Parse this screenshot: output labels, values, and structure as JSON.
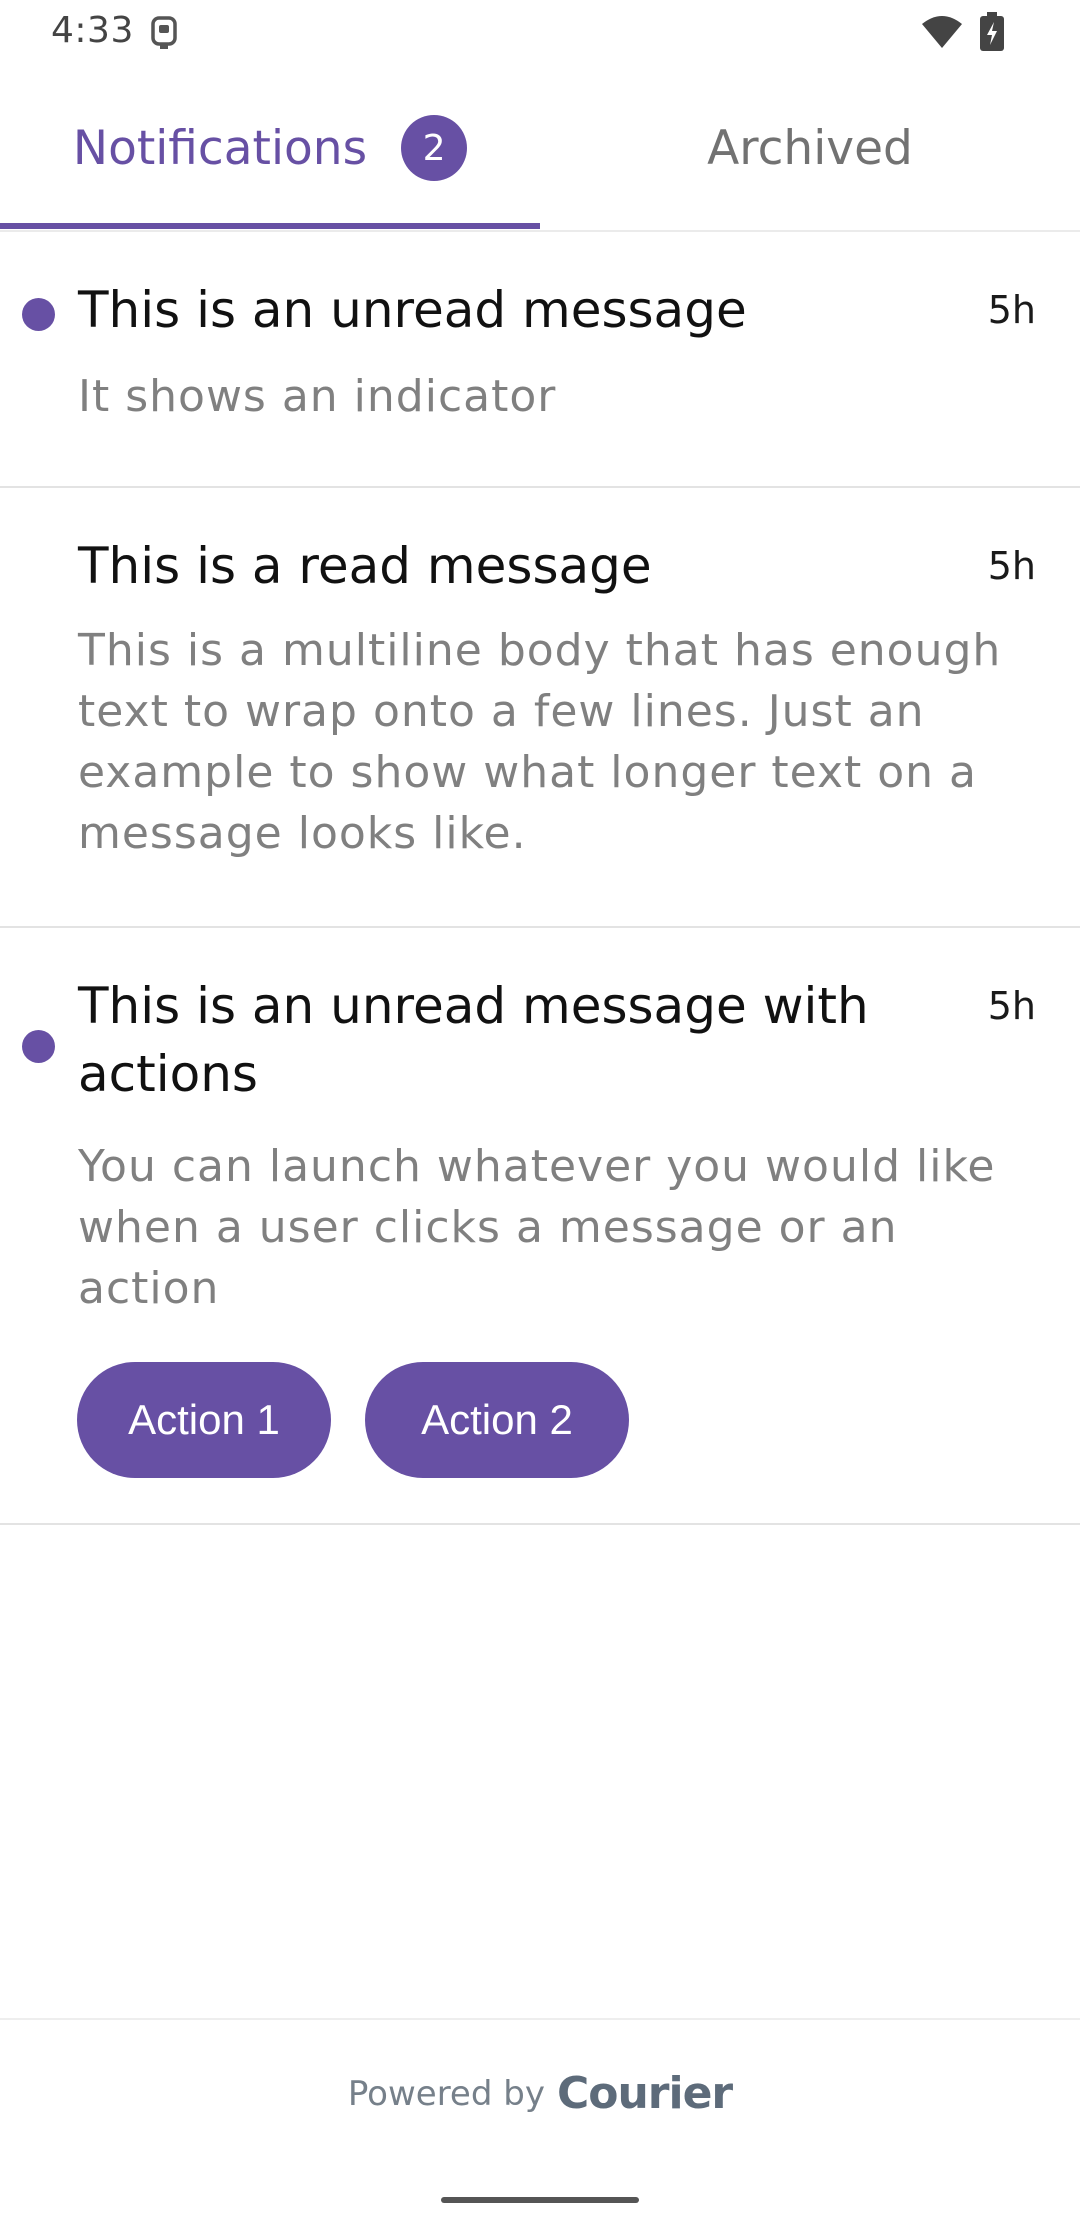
{
  "status_bar": {
    "time": "4:33",
    "icons": [
      "app-icon",
      "wifi-icon",
      "battery-charging-icon"
    ]
  },
  "tabs": [
    {
      "label": "Notifications",
      "badge": "2",
      "selected": true
    },
    {
      "label": "Archived",
      "selected": false
    }
  ],
  "messages": [
    {
      "title": "This is an unread message",
      "body": "It shows an indicator",
      "time": "5h",
      "unread": true
    },
    {
      "title": "This is a read message",
      "body": "This is a multiline body that has enough text to wrap onto a few lines. Just an example to show what longer text on a message looks like.",
      "time": "5h",
      "unread": false
    },
    {
      "title": "This is an unread message with actions",
      "body": "You can launch whatever you would like when a user clicks a message or an action",
      "time": "5h",
      "unread": true,
      "actions": [
        "Action 1",
        "Action 2"
      ]
    }
  ],
  "footer": {
    "powered_by": "Powered by",
    "brand": "Courier"
  },
  "colors": {
    "accent": "#6750a4",
    "body_text": "#808080",
    "inactive_tab": "#727272"
  }
}
